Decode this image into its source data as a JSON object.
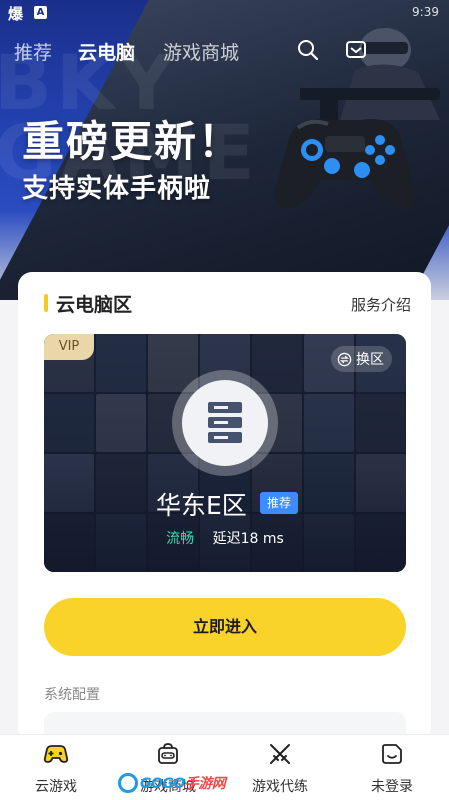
{
  "status_bar": {
    "app_glyph": "爆",
    "badge": "A",
    "time": "9:39"
  },
  "top_nav": {
    "tabs": [
      "推荐",
      "云电脑",
      "游戏商城"
    ],
    "active_index": 1
  },
  "banner": {
    "headline": "重磅更新！",
    "subheadline": "支持实体手柄啦",
    "bg_text_lines": [
      "BKY",
      "GAME"
    ]
  },
  "cloud_pc": {
    "section_title": "云电脑区",
    "service_link": "服务介绍",
    "vip_badge": "VIP",
    "switch_label": "换区",
    "server_name": "华东E区",
    "recommend_tag": "推荐",
    "status_text": "流畅",
    "latency_text": "延迟18 ms",
    "enter_button": "立即进入",
    "config_label": "系统配置"
  },
  "bottom_nav": {
    "items": [
      {
        "label": "云游戏",
        "icon": "gamepad-icon"
      },
      {
        "label": "游戏商城",
        "icon": "store-icon"
      },
      {
        "label": "游戏代练",
        "icon": "crossed-swords-icon"
      },
      {
        "label": "未登录",
        "icon": "user-face-icon"
      }
    ],
    "active_index": 0
  },
  "watermark": {
    "prefix": "GOGO",
    "suffix": "手游网"
  },
  "colors": {
    "accent_yellow": "#f9d32a",
    "hero_blue": "#2443b3",
    "recommend_blue": "#3d8cff",
    "smooth_green": "#46d6b0"
  }
}
